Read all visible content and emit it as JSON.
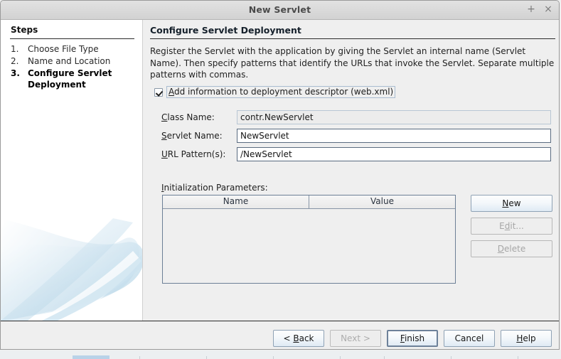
{
  "window": {
    "title": "New Servlet",
    "maximize_icon": "plus-icon",
    "close_icon": "close-icon",
    "maximize_glyph": "+",
    "close_glyph": "×"
  },
  "sidebar": {
    "heading": "Steps",
    "steps": [
      {
        "num": "1.",
        "label": "Choose File Type",
        "active": false
      },
      {
        "num": "2.",
        "label": "Name and Location",
        "active": false
      },
      {
        "num": "3.",
        "label": "Configure Servlet Deployment",
        "active": true
      }
    ]
  },
  "main": {
    "title": "Configure Servlet Deployment",
    "description": "Register the Servlet with the application by giving the Servlet an internal name (Servlet Name). Then specify patterns that identify the URLs that invoke the Servlet. Separate multiple patterns with commas.",
    "checkbox": {
      "label_prefix": "A",
      "label_rest": "dd information to deployment descriptor (web.xml)",
      "checked": true
    },
    "fields": [
      {
        "label_prefix": "C",
        "label_rest": "lass Name:",
        "value": "contr.NewServlet",
        "readonly": true
      },
      {
        "label_prefix": "S",
        "label_rest": "ervlet Name:",
        "value": "NewServlet",
        "readonly": false
      },
      {
        "label_prefix": "U",
        "label_rest": "RL Pattern(s):",
        "value": "/NewServlet",
        "readonly": false
      }
    ],
    "init_params": {
      "label_prefix": "I",
      "label_rest": "nitialization Parameters:",
      "columns": [
        "Name",
        "Value"
      ],
      "rows": []
    },
    "side_buttons": [
      {
        "prefix": "N",
        "mnemonic": "",
        "rest": "ew",
        "underline": "N",
        "before": "",
        "after": "ew",
        "label": "New",
        "disabled": false
      },
      {
        "before": "E",
        "underline": "d",
        "after": "it...",
        "label": "Edit...",
        "disabled": true
      },
      {
        "before": "",
        "underline": "D",
        "after": "elete",
        "label": "Delete",
        "disabled": true
      }
    ]
  },
  "footer": {
    "buttons": [
      {
        "before": "< ",
        "underline": "B",
        "after": "ack",
        "label": "< Back",
        "disabled": false,
        "focused": false
      },
      {
        "before": "Next >",
        "underline": "",
        "after": "",
        "label": "Next >",
        "disabled": true,
        "focused": false
      },
      {
        "before": "",
        "underline": "F",
        "after": "inish",
        "label": "Finish",
        "disabled": false,
        "focused": true
      },
      {
        "before": "Cancel",
        "underline": "",
        "after": "",
        "label": "Cancel",
        "disabled": false,
        "focused": false
      },
      {
        "before": "",
        "underline": "H",
        "after": "elp",
        "label": "Help",
        "disabled": false,
        "focused": false
      }
    ]
  },
  "colors": {
    "accent": "#b9d2e8",
    "dialog_bg": "#efefef",
    "panel_bg": "#ffffff",
    "rule": "#2b2b2b"
  }
}
